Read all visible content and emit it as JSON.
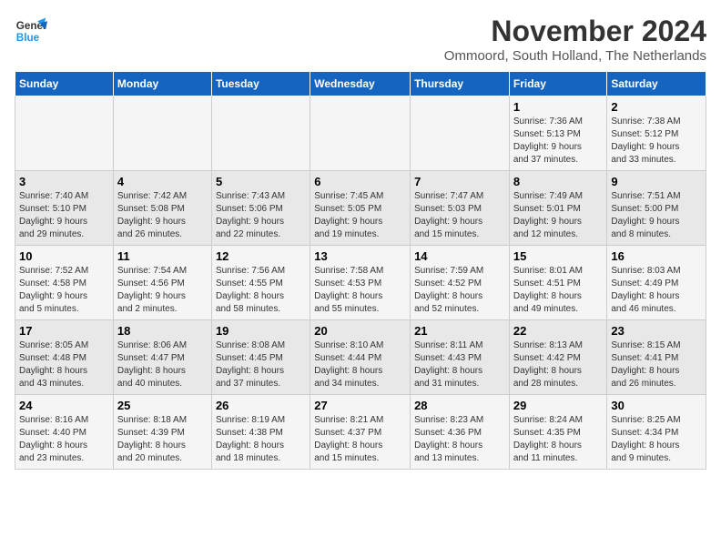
{
  "logo": {
    "line1": "General",
    "line2": "Blue"
  },
  "title": "November 2024",
  "subtitle": "Ommoord, South Holland, The Netherlands",
  "headers": [
    "Sunday",
    "Monday",
    "Tuesday",
    "Wednesday",
    "Thursday",
    "Friday",
    "Saturday"
  ],
  "weeks": [
    [
      {
        "day": "",
        "info": ""
      },
      {
        "day": "",
        "info": ""
      },
      {
        "day": "",
        "info": ""
      },
      {
        "day": "",
        "info": ""
      },
      {
        "day": "",
        "info": ""
      },
      {
        "day": "1",
        "info": "Sunrise: 7:36 AM\nSunset: 5:13 PM\nDaylight: 9 hours\nand 37 minutes."
      },
      {
        "day": "2",
        "info": "Sunrise: 7:38 AM\nSunset: 5:12 PM\nDaylight: 9 hours\nand 33 minutes."
      }
    ],
    [
      {
        "day": "3",
        "info": "Sunrise: 7:40 AM\nSunset: 5:10 PM\nDaylight: 9 hours\nand 29 minutes."
      },
      {
        "day": "4",
        "info": "Sunrise: 7:42 AM\nSunset: 5:08 PM\nDaylight: 9 hours\nand 26 minutes."
      },
      {
        "day": "5",
        "info": "Sunrise: 7:43 AM\nSunset: 5:06 PM\nDaylight: 9 hours\nand 22 minutes."
      },
      {
        "day": "6",
        "info": "Sunrise: 7:45 AM\nSunset: 5:05 PM\nDaylight: 9 hours\nand 19 minutes."
      },
      {
        "day": "7",
        "info": "Sunrise: 7:47 AM\nSunset: 5:03 PM\nDaylight: 9 hours\nand 15 minutes."
      },
      {
        "day": "8",
        "info": "Sunrise: 7:49 AM\nSunset: 5:01 PM\nDaylight: 9 hours\nand 12 minutes."
      },
      {
        "day": "9",
        "info": "Sunrise: 7:51 AM\nSunset: 5:00 PM\nDaylight: 9 hours\nand 8 minutes."
      }
    ],
    [
      {
        "day": "10",
        "info": "Sunrise: 7:52 AM\nSunset: 4:58 PM\nDaylight: 9 hours\nand 5 minutes."
      },
      {
        "day": "11",
        "info": "Sunrise: 7:54 AM\nSunset: 4:56 PM\nDaylight: 9 hours\nand 2 minutes."
      },
      {
        "day": "12",
        "info": "Sunrise: 7:56 AM\nSunset: 4:55 PM\nDaylight: 8 hours\nand 58 minutes."
      },
      {
        "day": "13",
        "info": "Sunrise: 7:58 AM\nSunset: 4:53 PM\nDaylight: 8 hours\nand 55 minutes."
      },
      {
        "day": "14",
        "info": "Sunrise: 7:59 AM\nSunset: 4:52 PM\nDaylight: 8 hours\nand 52 minutes."
      },
      {
        "day": "15",
        "info": "Sunrise: 8:01 AM\nSunset: 4:51 PM\nDaylight: 8 hours\nand 49 minutes."
      },
      {
        "day": "16",
        "info": "Sunrise: 8:03 AM\nSunset: 4:49 PM\nDaylight: 8 hours\nand 46 minutes."
      }
    ],
    [
      {
        "day": "17",
        "info": "Sunrise: 8:05 AM\nSunset: 4:48 PM\nDaylight: 8 hours\nand 43 minutes."
      },
      {
        "day": "18",
        "info": "Sunrise: 8:06 AM\nSunset: 4:47 PM\nDaylight: 8 hours\nand 40 minutes."
      },
      {
        "day": "19",
        "info": "Sunrise: 8:08 AM\nSunset: 4:45 PM\nDaylight: 8 hours\nand 37 minutes."
      },
      {
        "day": "20",
        "info": "Sunrise: 8:10 AM\nSunset: 4:44 PM\nDaylight: 8 hours\nand 34 minutes."
      },
      {
        "day": "21",
        "info": "Sunrise: 8:11 AM\nSunset: 4:43 PM\nDaylight: 8 hours\nand 31 minutes."
      },
      {
        "day": "22",
        "info": "Sunrise: 8:13 AM\nSunset: 4:42 PM\nDaylight: 8 hours\nand 28 minutes."
      },
      {
        "day": "23",
        "info": "Sunrise: 8:15 AM\nSunset: 4:41 PM\nDaylight: 8 hours\nand 26 minutes."
      }
    ],
    [
      {
        "day": "24",
        "info": "Sunrise: 8:16 AM\nSunset: 4:40 PM\nDaylight: 8 hours\nand 23 minutes."
      },
      {
        "day": "25",
        "info": "Sunrise: 8:18 AM\nSunset: 4:39 PM\nDaylight: 8 hours\nand 20 minutes."
      },
      {
        "day": "26",
        "info": "Sunrise: 8:19 AM\nSunset: 4:38 PM\nDaylight: 8 hours\nand 18 minutes."
      },
      {
        "day": "27",
        "info": "Sunrise: 8:21 AM\nSunset: 4:37 PM\nDaylight: 8 hours\nand 15 minutes."
      },
      {
        "day": "28",
        "info": "Sunrise: 8:23 AM\nSunset: 4:36 PM\nDaylight: 8 hours\nand 13 minutes."
      },
      {
        "day": "29",
        "info": "Sunrise: 8:24 AM\nSunset: 4:35 PM\nDaylight: 8 hours\nand 11 minutes."
      },
      {
        "day": "30",
        "info": "Sunrise: 8:25 AM\nSunset: 4:34 PM\nDaylight: 8 hours\nand 9 minutes."
      }
    ]
  ]
}
